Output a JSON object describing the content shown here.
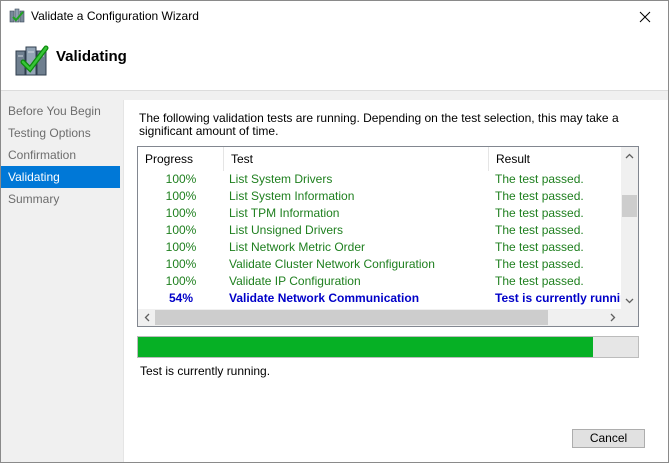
{
  "window": {
    "title": "Validate a Configuration Wizard",
    "icon": "cluster-wizard-icon"
  },
  "header": {
    "title": "Validating",
    "icon": "validation-checkmark-icon"
  },
  "sidebar": {
    "items": [
      {
        "label": "Before You Begin",
        "active": false
      },
      {
        "label": "Testing Options",
        "active": false
      },
      {
        "label": "Confirmation",
        "active": false
      },
      {
        "label": "Validating",
        "active": true
      },
      {
        "label": "Summary",
        "active": false
      }
    ]
  },
  "main": {
    "description": "The following validation tests are running. Depending on the test selection, this may take a significant amount of time.",
    "table": {
      "columns": [
        "Progress",
        "Test",
        "Result"
      ],
      "rows": [
        {
          "progress": "100%",
          "test": "List System Drivers",
          "result": "The test passed."
        },
        {
          "progress": "100%",
          "test": "List System Information",
          "result": "The test passed."
        },
        {
          "progress": "100%",
          "test": "List TPM Information",
          "result": "The test passed."
        },
        {
          "progress": "100%",
          "test": "List Unsigned Drivers",
          "result": "The test passed."
        },
        {
          "progress": "100%",
          "test": "List Network Metric Order",
          "result": "The test passed."
        },
        {
          "progress": "100%",
          "test": "Validate Cluster Network Configuration",
          "result": "The test passed."
        },
        {
          "progress": "100%",
          "test": "Validate IP Configuration",
          "result": "The test passed."
        },
        {
          "progress": "54%",
          "test": "Validate Network Communication",
          "result": "Test is currently running..."
        }
      ]
    },
    "progress_fraction": 0.91,
    "status": "Test is currently running."
  },
  "footer": {
    "cancel_label": "Cancel"
  },
  "colors": {
    "accent": "#0078d7",
    "passed": "#1e7f1e",
    "running": "#0000c8",
    "progress_fill": "#06b025"
  }
}
